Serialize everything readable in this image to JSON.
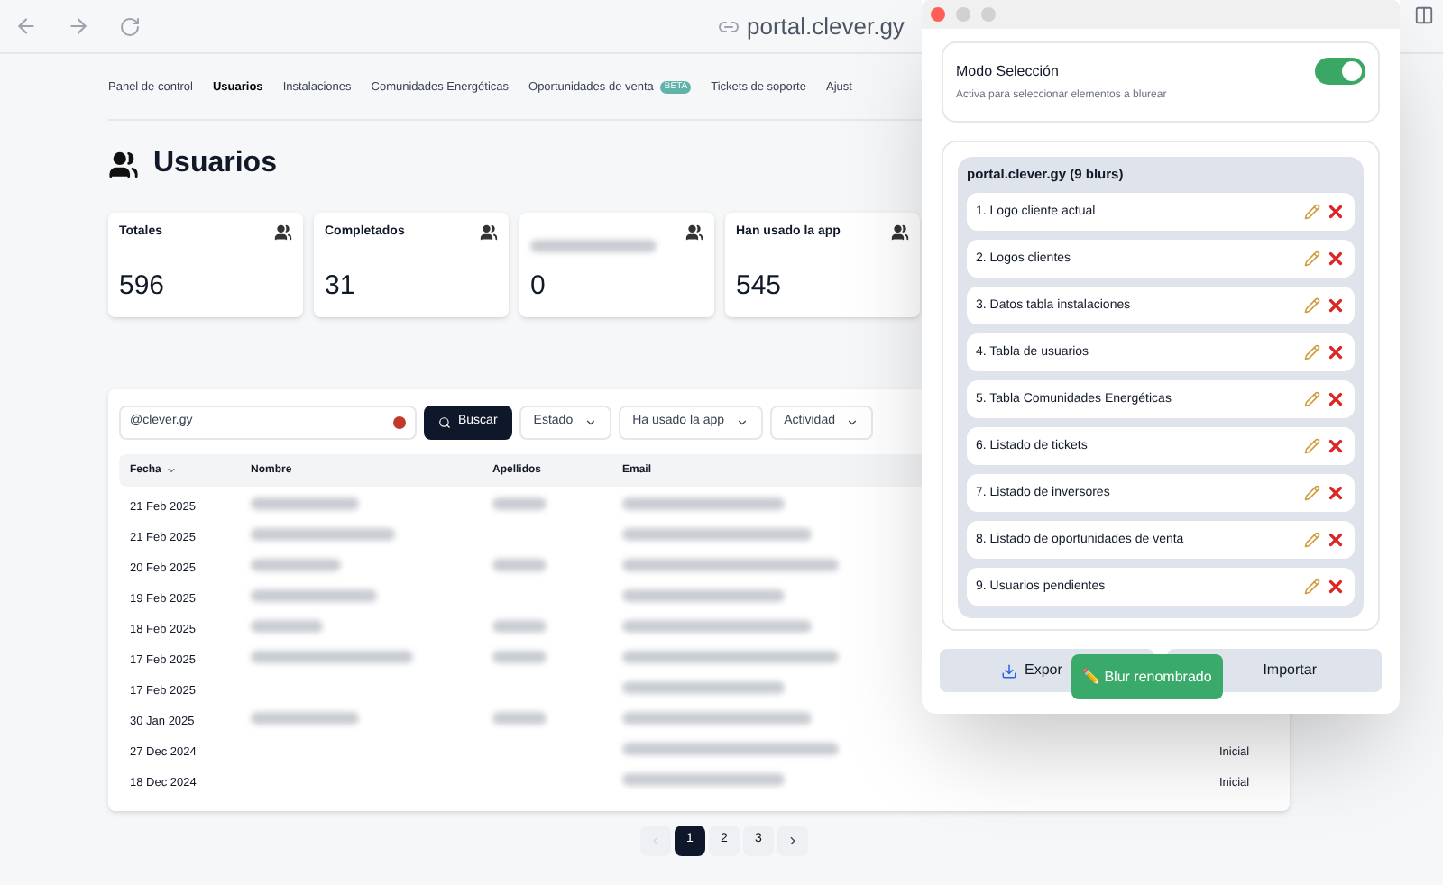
{
  "browser": {
    "url": "portal.clever.gy"
  },
  "nav": [
    {
      "label": "Panel de control",
      "selected": false
    },
    {
      "label": "Usuarios",
      "selected": true
    },
    {
      "label": "Instalaciones",
      "selected": false
    },
    {
      "label": "Comunidades Energéticas",
      "selected": false
    },
    {
      "label": "Oportunidades de venta",
      "selected": false,
      "badge": "BETA"
    },
    {
      "label": "Tickets de soporte",
      "selected": false
    },
    {
      "label": "Ajust",
      "selected": false
    }
  ],
  "page_title": "Usuarios",
  "stats": [
    {
      "title": "Totales",
      "value": "596",
      "title_blurred": false
    },
    {
      "title": "Completados",
      "value": "31",
      "title_blurred": false
    },
    {
      "value": "0",
      "title_blurred": true
    },
    {
      "title": "Han usado la app",
      "value": "545",
      "title_blurred": false
    }
  ],
  "filters": {
    "search_value": "@clever.gy",
    "search_button": "Buscar",
    "dropdowns": [
      "Estado",
      "Ha usado la app",
      "Actividad"
    ]
  },
  "table": {
    "columns": [
      "Fecha",
      "Nombre",
      "Apellidos",
      "Email"
    ],
    "rows": [
      {
        "date": "21 Feb 2025",
        "name_blurred": true,
        "surname_blurred": true,
        "email_blurred": true
      },
      {
        "date": "21 Feb 2025",
        "name_blurred": true,
        "surname_blurred": false,
        "email_blurred": true
      },
      {
        "date": "20 Feb 2025",
        "name_blurred": true,
        "surname_blurred": true,
        "email_blurred": true
      },
      {
        "date": "19 Feb 2025",
        "name_blurred": true,
        "surname_blurred": false,
        "email_blurred": true
      },
      {
        "date": "18 Feb 2025",
        "name_blurred": true,
        "surname_blurred": true,
        "email_blurred": true
      },
      {
        "date": "17 Feb 2025",
        "name_blurred": true,
        "surname_blurred": true,
        "email_blurred": true
      },
      {
        "date": "17 Feb 2025",
        "name_blurred": false,
        "surname_blurred": false,
        "email_blurred": true
      },
      {
        "date": "30 Jan 2025",
        "name_blurred": true,
        "surname_blurred": true,
        "email_blurred": true
      },
      {
        "date": "27 Dec 2024",
        "name_blurred": false,
        "surname_blurred": false,
        "email_blurred": true,
        "status": "Inicial"
      },
      {
        "date": "18 Dec 2024",
        "name_blurred": false,
        "surname_blurred": false,
        "email_blurred": true,
        "status": "Inicial"
      }
    ]
  },
  "pagination": [
    {
      "label": "1",
      "selected": true
    },
    {
      "label": "2",
      "selected": false
    },
    {
      "label": "3",
      "selected": false
    }
  ],
  "popup": {
    "mode_title": "Modo Selección",
    "mode_on": true,
    "mode_hint": "Activa para seleccionar elementos a blurear",
    "group_title": "portal.clever.gy (9 blurs)",
    "items": [
      "1. Logo cliente actual",
      "2. Logos clientes",
      "3. Datos tabla instalaciones",
      "4. Tabla de usuarios",
      "5. Tabla Comunidades Energéticas",
      "6. Listado de tickets",
      "7. Listado de inversores",
      "8. Listado de oportunidades de venta",
      "9. Usuarios pendientes"
    ],
    "export_label": "Expor",
    "import_label": "Importar",
    "toast": "✏️ Blur renombrado"
  }
}
